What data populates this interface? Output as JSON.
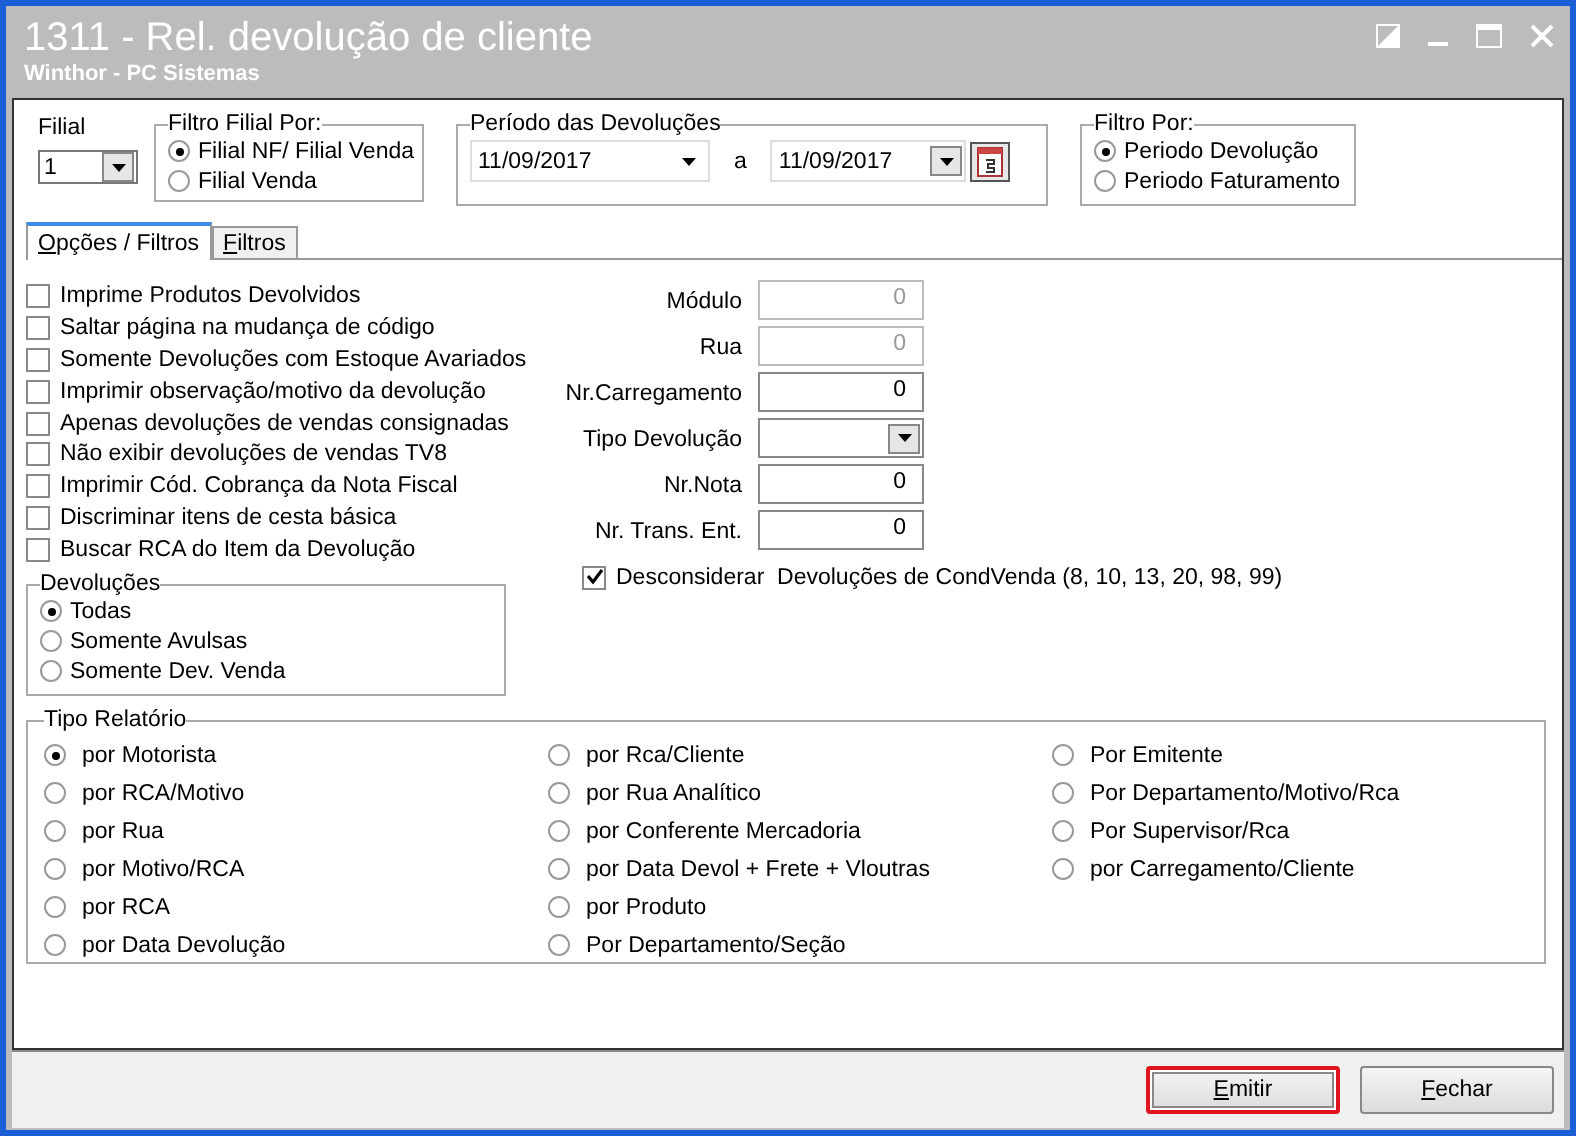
{
  "window": {
    "title": "1311 - Rel. devolução de cliente",
    "subtitle": "Winthor - PC Sistemas"
  },
  "filial": {
    "label": "Filial",
    "value": "1"
  },
  "filtro_filial": {
    "title": "Filtro Filial Por:",
    "options": [
      {
        "label": "Filial NF/ Filial Venda",
        "selected": true
      },
      {
        "label": "Filial Venda",
        "selected": false
      }
    ]
  },
  "periodo": {
    "title": "Período das Devoluções",
    "start": "11/09/2017",
    "separator": "a",
    "end": "11/09/2017"
  },
  "filtro_por": {
    "title": "Filtro Por:",
    "options": [
      {
        "label": "Periodo Devolução",
        "selected": true
      },
      {
        "label": "Periodo Faturamento",
        "selected": false
      }
    ]
  },
  "tabs": [
    {
      "label": "Opções / Filtros",
      "selected": true
    },
    {
      "label": "Filtros",
      "selected": false
    }
  ],
  "options": [
    {
      "label": "Imprime Produtos Devolvidos",
      "checked": false
    },
    {
      "label": "Saltar página na mudança de código",
      "checked": false
    },
    {
      "label": "Somente Devoluções com Estoque Avariados",
      "checked": false
    },
    {
      "label": "Imprimir observação/motivo da devolução",
      "checked": false
    },
    {
      "label": "Apenas devoluções de vendas consignadas",
      "checked": false
    },
    {
      "label": "Não exibir devoluções de vendas TV8",
      "checked": false
    },
    {
      "label": "Imprimir Cód. Cobrança da Nota Fiscal",
      "checked": false
    },
    {
      "label": "Discriminar itens de cesta básica",
      "checked": false
    },
    {
      "label": "Buscar RCA do Item da Devolução",
      "checked": false
    }
  ],
  "fields": [
    {
      "label": "Módulo",
      "kind": "text",
      "value": "0",
      "disabled": true
    },
    {
      "label": "Rua",
      "kind": "text",
      "value": "0",
      "disabled": true
    },
    {
      "label": "Nr.Carregamento",
      "kind": "text",
      "value": "0",
      "disabled": false
    },
    {
      "label": "Tipo Devolução",
      "kind": "combo",
      "disabled": false
    },
    {
      "label": "Nr.Nota",
      "kind": "text",
      "value": "0",
      "disabled": false
    },
    {
      "label": "Nr. Trans. Ent.",
      "kind": "text",
      "value": "0",
      "disabled": false
    }
  ],
  "devolucoes": {
    "title": "Devoluções",
    "options": [
      {
        "label": "Todas",
        "selected": true
      },
      {
        "label": "Somente Avulsas",
        "selected": false
      },
      {
        "label": "Somente Dev. Venda",
        "selected": false
      }
    ]
  },
  "desconsiderar": {
    "label": "Desconsiderar  Devoluções de CondVenda (8, 10, 13, 20, 98, 99)",
    "checked": true
  },
  "tipo_relatorio": {
    "title": "Tipo Relatório",
    "columns": [
      [
        {
          "label": "por Motorista",
          "selected": true
        },
        {
          "label": "por RCA/Motivo",
          "selected": false
        },
        {
          "label": "por Rua",
          "selected": false
        },
        {
          "label": "por Motivo/RCA",
          "selected": false
        },
        {
          "label": "por RCA",
          "selected": false
        },
        {
          "label": "por Data Devolução",
          "selected": false
        }
      ],
      [
        {
          "label": "por Rca/Cliente",
          "selected": false
        },
        {
          "label": "por Rua Analítico",
          "selected": false
        },
        {
          "label": "por Conferente Mercadoria",
          "selected": false
        },
        {
          "label": "por Data Devol + Frete + Vloutras",
          "selected": false
        },
        {
          "label": "por Produto",
          "selected": false
        },
        {
          "label": "Por Departamento/Seção",
          "selected": false
        }
      ],
      [
        {
          "label": "Por Emitente",
          "selected": false
        },
        {
          "label": "Por Departamento/Motivo/Rca",
          "selected": false
        },
        {
          "label": "Por Supervisor/Rca",
          "selected": false
        },
        {
          "label": "por Carregamento/Cliente",
          "selected": false
        }
      ]
    ]
  },
  "buttons": [
    {
      "label": "Emitir",
      "highlighted": true
    },
    {
      "label": "Fechar",
      "highlighted": false
    }
  ]
}
